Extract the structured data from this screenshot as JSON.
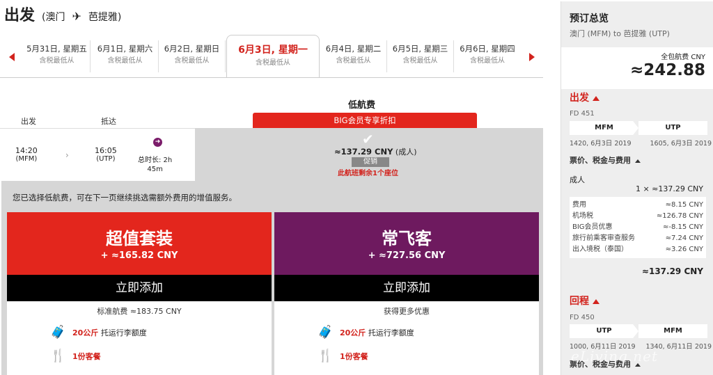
{
  "header": {
    "title": "出发",
    "from": "(澳门",
    "to": "芭提雅)"
  },
  "dates": [
    {
      "date": "5月31日, 星期五",
      "sub": "含税最低从"
    },
    {
      "date": "6月1日, 星期六",
      "sub": "含税最低从"
    },
    {
      "date": "6月2日, 星期日",
      "sub": "含税最低从"
    },
    {
      "date": "6月3日, 星期一",
      "sub": "含税最低从",
      "selected": true
    },
    {
      "date": "6月4日, 星期二",
      "sub": "含税最低从"
    },
    {
      "date": "6月5日, 星期三",
      "sub": "含税最低从"
    },
    {
      "date": "6月6日, 星期四",
      "sub": "含税最低从"
    }
  ],
  "fare": {
    "title": "低航费",
    "big_banner": "BIG会员专享折扣",
    "price": "≈137.29 CNY",
    "price_suffix": "(成人)",
    "promo": "促销",
    "seats": "此航班剩余1个座位"
  },
  "columns": {
    "depart": "出发",
    "arrive": "抵达"
  },
  "flight": {
    "dep_time": "14:20",
    "dep_code": "(MFM)",
    "arr_time": "16:05",
    "arr_code": "(UTP)",
    "duration_l1": "总时长: 2h",
    "duration_l2": "45m"
  },
  "notice": "您已选择低航费，可在下一页继续挑选需额外费用的增值服务。",
  "cards": [
    {
      "name": "超值套装",
      "price": "+ ≈165.82 CNY",
      "button": "立即添加",
      "sub": "标准航费 ≈183.75 CNY",
      "bag_em": "20公斤",
      "bag": "托运行李额度",
      "meal": "1份客餐",
      "color": "#e3261d"
    },
    {
      "name": "常飞客",
      "price": "+ ≈727.56 CNY",
      "button": "立即添加",
      "sub": "获得更多优惠",
      "bag_em": "20公斤",
      "bag": "托运行李额度",
      "meal": "1份客餐",
      "color": "#6e1a5f"
    }
  ],
  "summary": {
    "title": "预订总览",
    "route": "澳门 (MFM) to 芭提雅 (UTP)",
    "total_label": "全包航费 CNY",
    "total": "≈242.88",
    "depart": {
      "label": "出发",
      "flight": "FD 451",
      "from": "MFM",
      "to": "UTP",
      "dep": "1420, 6月3日 2019",
      "arr": "1605, 6月3日 2019"
    },
    "tax_label": "票价、税金与费用",
    "adult": "成人",
    "adult_val": "1 × ≈137.29 CNY",
    "fees": [
      {
        "k": "费用",
        "v": "≈8.15 CNY"
      },
      {
        "k": "机场税",
        "v": "≈126.78 CNY"
      },
      {
        "k": "BIG会员优惠",
        "v": "≈-8.15 CNY"
      },
      {
        "k": "旅行前乘客审查服务",
        "v": "≈7.24 CNY"
      },
      {
        "k": "出入境税（泰国）",
        "v": "≈3.26 CNY"
      }
    ],
    "subtotal": "≈137.29 CNY",
    "return": {
      "label": "回程",
      "flight": "FD 450",
      "from": "UTP",
      "to": "MFM",
      "dep": "1000, 6月11日 2019",
      "arr": "1340, 6月11日 2019"
    },
    "tax_label2": "票价、税金与费用"
  },
  "watermark": "eLiving.net"
}
